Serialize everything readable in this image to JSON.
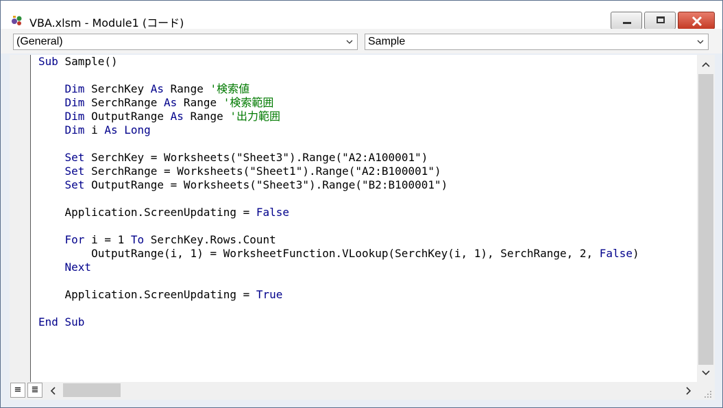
{
  "window": {
    "title": "VBA.xlsm - Module1 (コード)",
    "icon": "vba-module-icon"
  },
  "controls": {
    "minimize": "minimize-icon",
    "maximize": "maximize-icon",
    "close": "close-icon"
  },
  "object_dropdown": {
    "value": "(General)"
  },
  "procedure_dropdown": {
    "value": "Sample"
  },
  "colors": {
    "keyword": "#00008b",
    "comment": "#007a00",
    "close_button": "#c43a25"
  },
  "code": {
    "lines": [
      [
        {
          "t": "Sub",
          "c": "kw"
        },
        {
          "t": " Sample()",
          "c": ""
        }
      ],
      [],
      [
        {
          "t": "    ",
          "c": ""
        },
        {
          "t": "Dim",
          "c": "kw"
        },
        {
          "t": " SerchKey ",
          "c": ""
        },
        {
          "t": "As",
          "c": "kw"
        },
        {
          "t": " Range ",
          "c": ""
        },
        {
          "t": "'検索値",
          "c": "cm"
        }
      ],
      [
        {
          "t": "    ",
          "c": ""
        },
        {
          "t": "Dim",
          "c": "kw"
        },
        {
          "t": " SerchRange ",
          "c": ""
        },
        {
          "t": "As",
          "c": "kw"
        },
        {
          "t": " Range ",
          "c": ""
        },
        {
          "t": "'検索範囲",
          "c": "cm"
        }
      ],
      [
        {
          "t": "    ",
          "c": ""
        },
        {
          "t": "Dim",
          "c": "kw"
        },
        {
          "t": " OutputRange ",
          "c": ""
        },
        {
          "t": "As",
          "c": "kw"
        },
        {
          "t": " Range ",
          "c": ""
        },
        {
          "t": "'出力範囲",
          "c": "cm"
        }
      ],
      [
        {
          "t": "    ",
          "c": ""
        },
        {
          "t": "Dim",
          "c": "kw"
        },
        {
          "t": " i ",
          "c": ""
        },
        {
          "t": "As",
          "c": "kw"
        },
        {
          "t": " ",
          "c": ""
        },
        {
          "t": "Long",
          "c": "kw"
        }
      ],
      [],
      [
        {
          "t": "    ",
          "c": ""
        },
        {
          "t": "Set",
          "c": "kw"
        },
        {
          "t": " SerchKey = Worksheets(\"Sheet3\").Range(\"A2:A100001\")",
          "c": ""
        }
      ],
      [
        {
          "t": "    ",
          "c": ""
        },
        {
          "t": "Set",
          "c": "kw"
        },
        {
          "t": " SerchRange = Worksheets(\"Sheet1\").Range(\"A2:B100001\")",
          "c": ""
        }
      ],
      [
        {
          "t": "    ",
          "c": ""
        },
        {
          "t": "Set",
          "c": "kw"
        },
        {
          "t": " OutputRange = Worksheets(\"Sheet3\").Range(\"B2:B100001\")",
          "c": ""
        }
      ],
      [],
      [
        {
          "t": "    Application.ScreenUpdating = ",
          "c": ""
        },
        {
          "t": "False",
          "c": "kw"
        }
      ],
      [],
      [
        {
          "t": "    ",
          "c": ""
        },
        {
          "t": "For",
          "c": "kw"
        },
        {
          "t": " i = 1 ",
          "c": ""
        },
        {
          "t": "To",
          "c": "kw"
        },
        {
          "t": " SerchKey.Rows.Count",
          "c": ""
        }
      ],
      [
        {
          "t": "        OutputRange(i, 1) = WorksheetFunction.VLookup(SerchKey(i, 1), SerchRange, 2, ",
          "c": ""
        },
        {
          "t": "False",
          "c": "kw"
        },
        {
          "t": ")",
          "c": ""
        }
      ],
      [
        {
          "t": "    ",
          "c": ""
        },
        {
          "t": "Next",
          "c": "kw"
        }
      ],
      [],
      [
        {
          "t": "    Application.ScreenUpdating = ",
          "c": ""
        },
        {
          "t": "True",
          "c": "kw"
        }
      ],
      [],
      [
        {
          "t": "End Sub",
          "c": "kw"
        }
      ]
    ]
  },
  "bottom": {
    "procedure_view": "≡",
    "full_module_view": "≣"
  }
}
